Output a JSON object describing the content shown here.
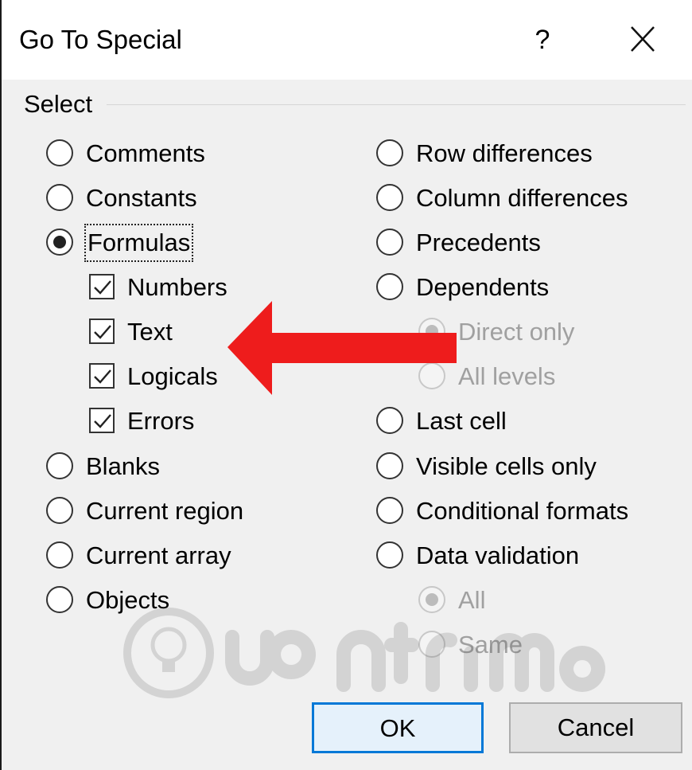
{
  "dialog": {
    "title": "Go To Special",
    "help_label": "?",
    "close_label": "X"
  },
  "group": {
    "label": "Select"
  },
  "left_options": [
    {
      "label": "Comments",
      "checked": false
    },
    {
      "label": "Constants",
      "checked": false
    },
    {
      "label": "Formulas",
      "checked": true
    },
    {
      "label": "Blanks",
      "checked": false
    },
    {
      "label": "Current region",
      "checked": false
    },
    {
      "label": "Current array",
      "checked": false
    },
    {
      "label": "Objects",
      "checked": false
    }
  ],
  "formula_types": [
    {
      "label": "Numbers",
      "checked": true
    },
    {
      "label": "Text",
      "checked": true
    },
    {
      "label": "Logicals",
      "checked": true
    },
    {
      "label": "Errors",
      "checked": true
    }
  ],
  "right_options": [
    {
      "label": "Row differences",
      "checked": false
    },
    {
      "label": "Column differences",
      "checked": false
    },
    {
      "label": "Precedents",
      "checked": false
    },
    {
      "label": "Dependents",
      "checked": false
    },
    {
      "label": "Last cell",
      "checked": false
    },
    {
      "label": "Visible cells only",
      "checked": false
    },
    {
      "label": "Conditional formats",
      "checked": false
    },
    {
      "label": "Data validation",
      "checked": false
    }
  ],
  "dependents_sub": [
    {
      "label": "Direct only",
      "checked": true,
      "disabled": true
    },
    {
      "label": "All levels",
      "checked": false,
      "disabled": true
    }
  ],
  "validation_sub": [
    {
      "label": "All",
      "checked": true,
      "disabled": true
    },
    {
      "label": "Same",
      "checked": false,
      "disabled": true
    }
  ],
  "buttons": {
    "ok": "OK",
    "cancel": "Cancel"
  },
  "annotation": {
    "arrow_color": "#ee1c1c",
    "arrow_points_to": "formula-type-checkboxes"
  },
  "watermark": {
    "text": "Quantrimang",
    "icon": "lightbulb-icon"
  },
  "colors": {
    "accent": "#0078d7",
    "background": "#f0f0f0",
    "titlebar": "#ffffff"
  }
}
